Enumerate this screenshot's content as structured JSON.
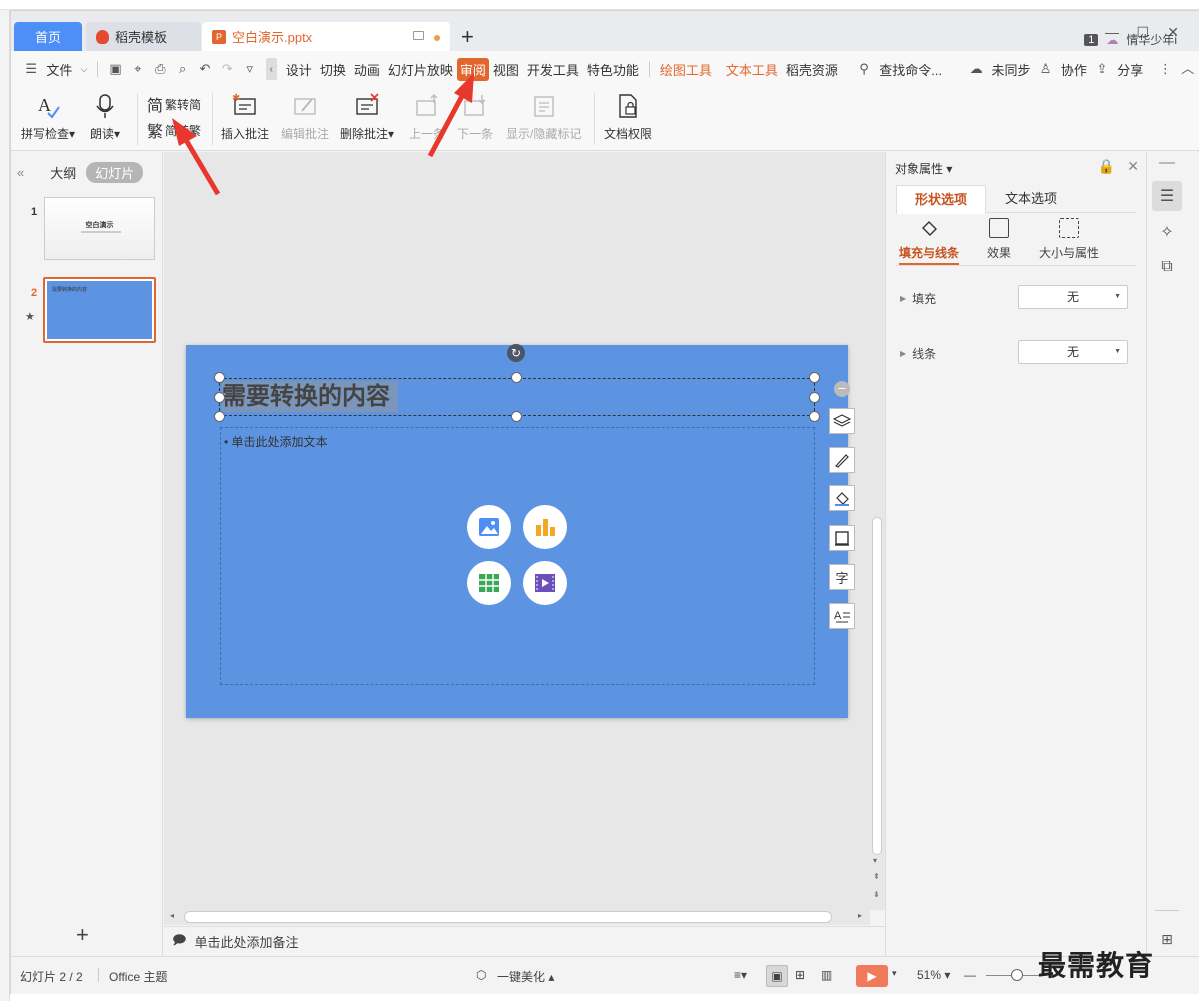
{
  "tabs": {
    "home": "首页",
    "template": "稻壳模板",
    "document": "空白演示.pptx",
    "add": "+"
  },
  "titlebar": {
    "badge": "1",
    "user": "情华少年i"
  },
  "menu": {
    "file": "文件",
    "items": [
      "设计",
      "切换",
      "动画",
      "幻灯片放映",
      "审阅",
      "视图",
      "开发工具",
      "特色功能"
    ],
    "contextual": [
      "绘图工具",
      "文本工具"
    ],
    "resources": "稻壳资源",
    "search": "查找命令...",
    "unsynced": "未同步",
    "collab": "协作",
    "share": "分享"
  },
  "ribbon": {
    "spell_check": "拼写检查",
    "read_aloud": "朗读",
    "trad_to_simp": "繁转简",
    "simp_to_trad": "简转繁",
    "insert_comment": "插入批注",
    "edit_comment": "编辑批注",
    "delete_comment": "删除批注",
    "prev": "上一条",
    "next": "下一条",
    "show_hide": "显示/隐藏标记",
    "doc_rights": "文档权限"
  },
  "left_panel": {
    "outline_tab": "大纲",
    "slides_tab": "幻灯片",
    "slide1_num": "1",
    "slide1_title": "空白演示",
    "slide2_num": "2",
    "slide2_title": "需要转换的内容",
    "add": "+"
  },
  "slide": {
    "title": "需要转换的内容",
    "body_placeholder": "• 单击此处添加文本"
  },
  "notes": {
    "placeholder": "单击此处添加备注"
  },
  "properties": {
    "title": "对象属性",
    "tab_shape": "形状选项",
    "tab_text": "文本选项",
    "sub_fill_line": "填充与线条",
    "sub_effects": "效果",
    "sub_size": "大小与属性",
    "fill_label": "填充",
    "fill_value": "无",
    "line_label": "线条",
    "line_value": "无"
  },
  "status": {
    "slide_count": "幻灯片 2 / 2",
    "theme": "Office 主题",
    "beautify": "一键美化",
    "zoom": "51%"
  },
  "watermark": "最需教育",
  "colors": {
    "accent": "#e2672f",
    "home_tab": "#4e8ef7",
    "slide_bg": "#5c94e2",
    "arrow": "#e8372c"
  }
}
